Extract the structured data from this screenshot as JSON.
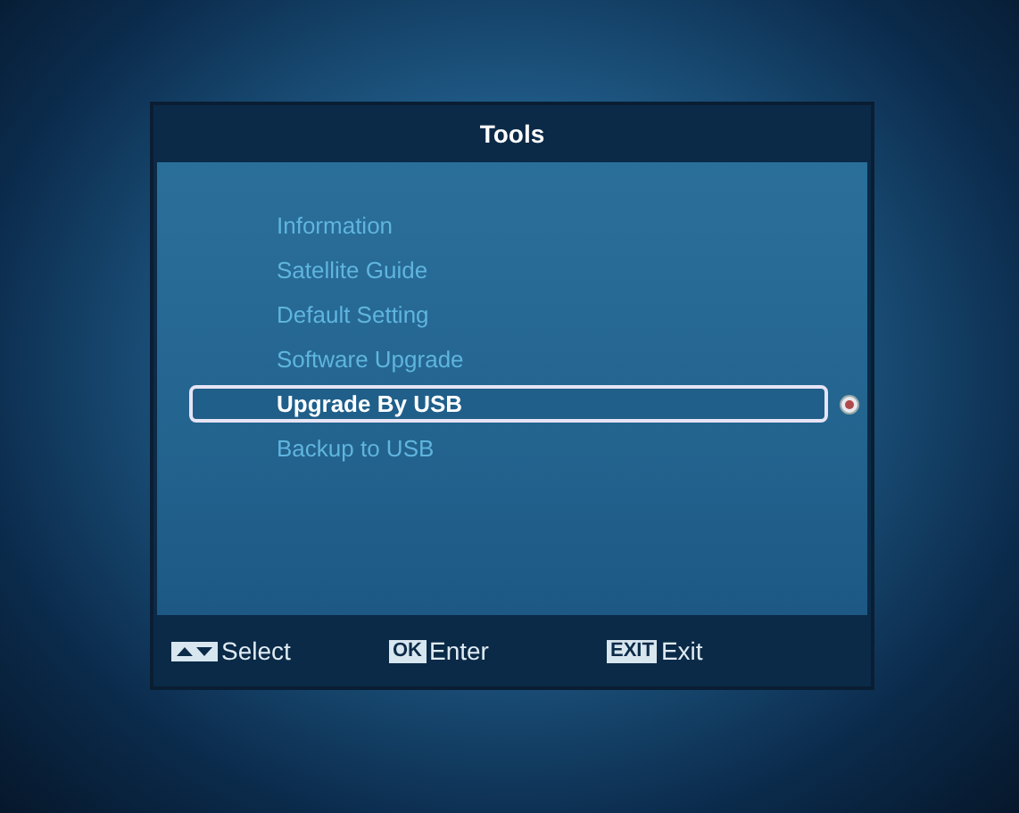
{
  "window": {
    "title": "Tools"
  },
  "menu": [
    {
      "label": "Information",
      "selected": false
    },
    {
      "label": "Satellite Guide",
      "selected": false
    },
    {
      "label": "Default Setting",
      "selected": false
    },
    {
      "label": "Software Upgrade",
      "selected": false
    },
    {
      "label": "Upgrade By USB",
      "selected": true
    },
    {
      "label": "Backup to USB",
      "selected": false
    }
  ],
  "hints": [
    {
      "kind": "arrows",
      "label": "Select"
    },
    {
      "kind": "key",
      "key": "OK",
      "label": "Enter"
    },
    {
      "kind": "key",
      "key": "EXIT",
      "label": "Exit"
    }
  ]
}
